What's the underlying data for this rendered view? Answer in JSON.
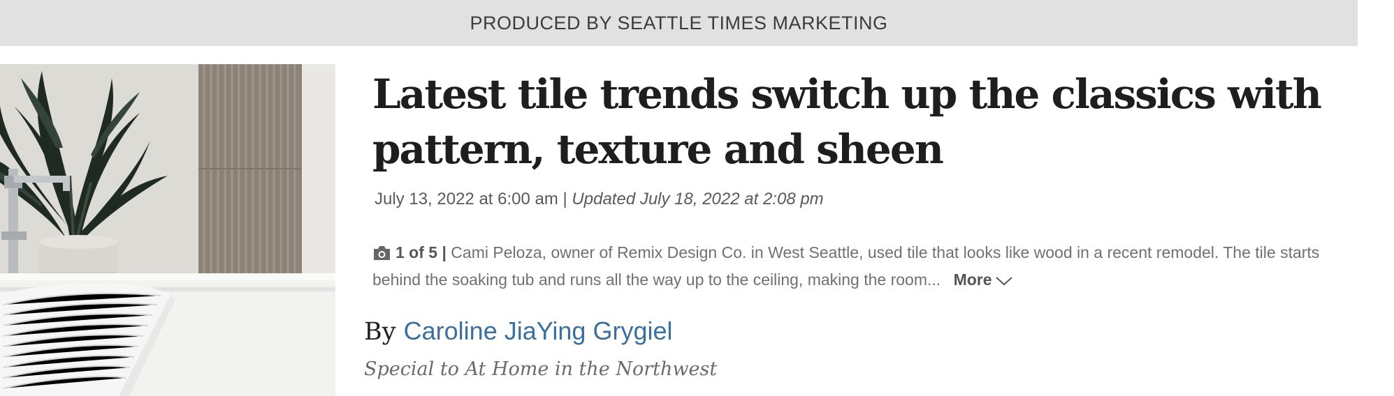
{
  "banner": {
    "text": "PRODUCED BY SEATTLE TIMES MARKETING"
  },
  "article": {
    "headline": "Latest tile trends switch up the classics with pattern, texture and sheen",
    "published": "July 13, 2022 at 6:00 am",
    "separator": "|",
    "updated": "Updated July 18, 2022 at 2:08 pm"
  },
  "photo": {
    "icon": "camera-icon",
    "count": "1 of 5",
    "separator": "|",
    "caption": "Cami Peloza, owner of Remix Design Co. in West Seattle, used tile that looks like wood in a recent remodel. The tile starts behind the soaking tub and runs all the way up to the ceiling, making the room...",
    "more_label": "More",
    "more_icon": "chevron-down-icon"
  },
  "byline": {
    "prefix": "By",
    "author": "Caroline JiaYing Grygiel",
    "affiliation": "Special to At Home in the Northwest"
  },
  "colors": {
    "banner_bg": "#e1e1e1",
    "headline": "#1e1e1e",
    "author_link": "#3b6f9e",
    "caption": "#707070"
  }
}
